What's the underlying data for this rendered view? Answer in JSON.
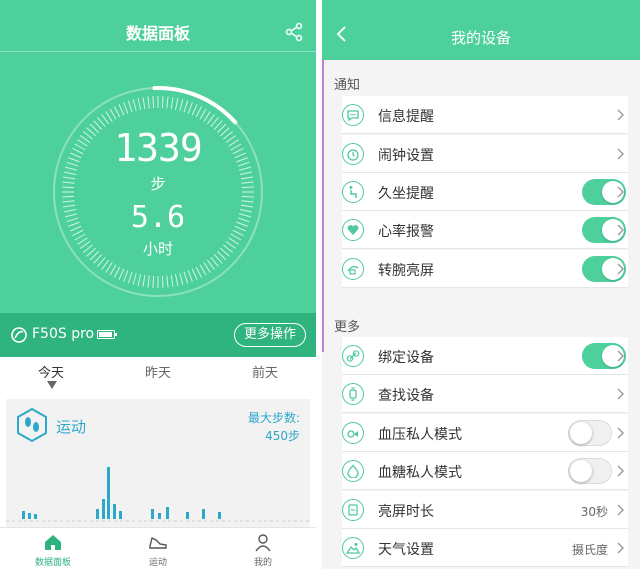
{
  "left": {
    "title": "数据面板",
    "steps": "1339",
    "steps_unit": "步",
    "hours": "5.6",
    "hours_unit": "小时",
    "device_name": "F50S pro",
    "battery_level": 0.9,
    "more_button": "更多操作",
    "days": [
      "今天",
      "昨天",
      "前天"
    ],
    "activity_label": "运动",
    "max_steps_label": "最大步数:",
    "max_steps_value": "450步",
    "tabs": [
      "数据面板",
      "运动",
      "我的"
    ],
    "colors": {
      "primary": "#4ed09d",
      "dark": "#2fb37f",
      "activity": "#2ea8c9"
    }
  },
  "right": {
    "title": "我的设备",
    "section_notify": "通知",
    "section_more": "更多",
    "rows": [
      {
        "label": "信息提醒",
        "icon": "message-icon",
        "control": "chevron"
      },
      {
        "label": "闹钟设置",
        "icon": "alarm-clock-icon",
        "control": "chevron"
      },
      {
        "label": "久坐提醒",
        "icon": "sitting-person-icon",
        "control": "toggle-on"
      },
      {
        "label": "心率报警",
        "icon": "heart-icon",
        "control": "toggle-on"
      },
      {
        "label": "转腕亮屏",
        "icon": "wrist-turn-icon",
        "control": "toggle-on"
      },
      {
        "label": "绑定设备",
        "icon": "link-icon",
        "control": "toggle-on"
      },
      {
        "label": "查找设备",
        "icon": "watch-icon",
        "control": "chevron"
      },
      {
        "label": "血压私人模式",
        "icon": "blood-pressure-icon",
        "control": "toggle-off"
      },
      {
        "label": "血糖私人模式",
        "icon": "blood-drop-icon",
        "control": "toggle-off"
      },
      {
        "label": "亮屏时长",
        "icon": "screen-time-icon",
        "control": "chevron",
        "value": "30秒"
      },
      {
        "label": "天气设置",
        "icon": "weather-icon",
        "control": "chevron",
        "value": "摄氏度"
      }
    ]
  }
}
